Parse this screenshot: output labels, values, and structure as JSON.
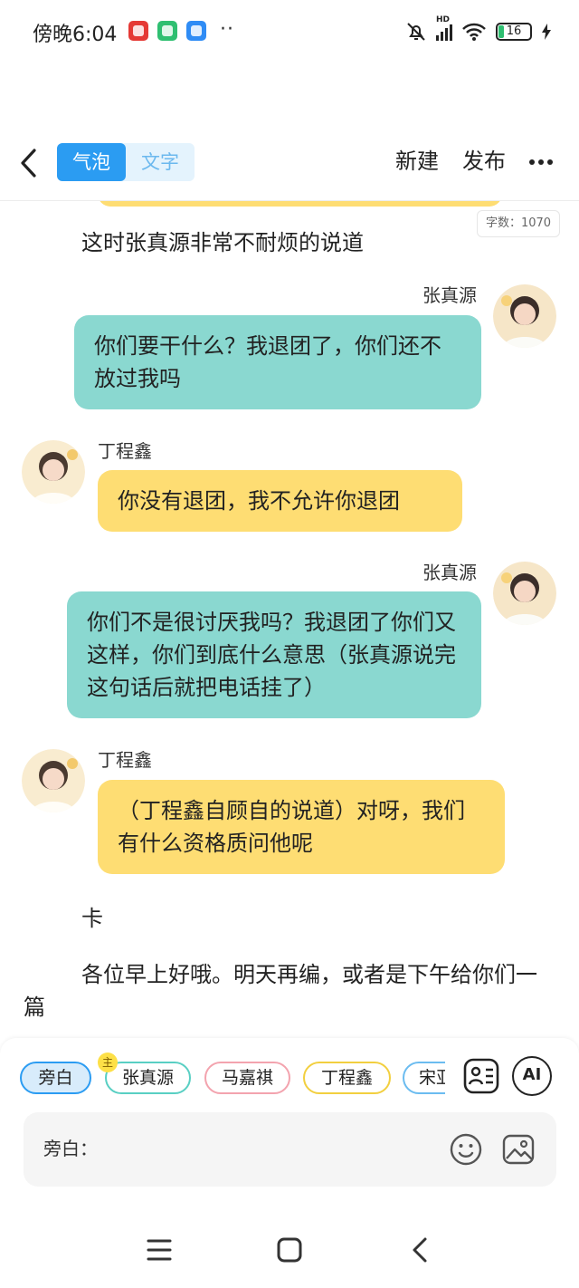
{
  "status_bar": {
    "time": "傍晚6:04",
    "more_dots": "··",
    "battery_level": "16",
    "network_label": "HD"
  },
  "header": {
    "tabs": [
      {
        "label": "气泡",
        "active": true
      },
      {
        "label": "文字",
        "active": false
      }
    ],
    "new_label": "新建",
    "publish_label": "发布"
  },
  "chat": {
    "word_count": "字数：1070",
    "messages": [
      {
        "type": "narration",
        "text": "这时张真源非常不耐烦的说道"
      },
      {
        "type": "bubble",
        "side": "right",
        "speaker": "张真源",
        "color": "#8ad8d0",
        "text": "你们要干什么？我退团了，你们还不放过我吗"
      },
      {
        "type": "bubble",
        "side": "left",
        "speaker": "丁程鑫",
        "color": "#fedd73",
        "text": "你没有退团，我不允许你退团"
      },
      {
        "type": "bubble",
        "side": "right",
        "speaker": "张真源",
        "color": "#8ad8d0",
        "text": "你们不是很讨厌我吗？我退团了你们又这样，你们到底什么意思（张真源说完这句话后就把电话挂了）"
      },
      {
        "type": "bubble",
        "side": "left",
        "speaker": "丁程鑫",
        "color": "#fedd73",
        "text": "（丁程鑫自顾自的说道）对呀，我们有什么资格质问他呢"
      },
      {
        "type": "narration",
        "text": "卡"
      },
      {
        "type": "narration",
        "text": "各位早上好哦。明天再编，或者是下午给你们一篇"
      }
    ]
  },
  "composer": {
    "roles": [
      {
        "label": "旁白",
        "color": "#2b9cf2",
        "selected": true
      },
      {
        "label": "张真源",
        "color": "#59cfc3"
      },
      {
        "label": "马嘉祺",
        "color": "#f3a3ae"
      },
      {
        "label": "丁程鑫",
        "color": "#f2cf3f"
      },
      {
        "label": "宋亚",
        "color": "#6bbcf0"
      }
    ],
    "host_badge": "主",
    "ai_label": "AI",
    "input_label": "旁白："
  }
}
